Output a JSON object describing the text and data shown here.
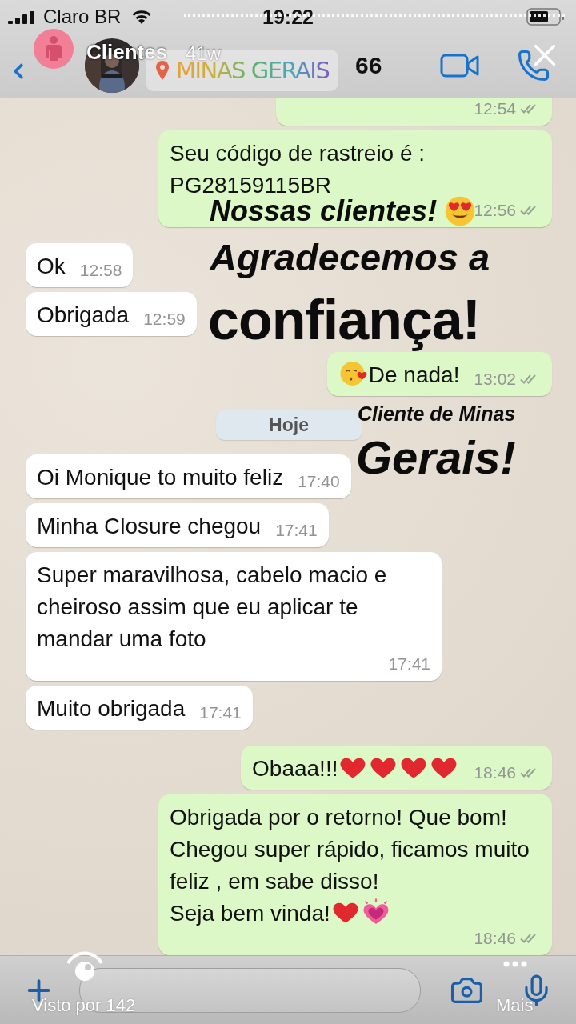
{
  "status_bar": {
    "carrier": "Claro BR",
    "time": "19:22"
  },
  "story": {
    "user": "Clientes",
    "age": "41w",
    "location": "MINAS GERAIS",
    "viewers": "Visto por 142",
    "more": "Mais"
  },
  "chat_header": {
    "count": "66"
  },
  "messages": [
    {
      "kind": "clipped",
      "time": "12:54",
      "read": false
    },
    {
      "kind": "sent",
      "lines": [
        "Seu código de rastreio é : PG28159115BR"
      ],
      "time": "12:56",
      "read": false
    },
    {
      "kind": "received",
      "lines": [
        "Ok"
      ],
      "time": "12:58"
    },
    {
      "kind": "received",
      "lines": [
        "Obrigada"
      ],
      "time": "12:59"
    },
    {
      "kind": "sent",
      "lead_icons": [
        {
          "kind": "kiss"
        }
      ],
      "lines": [
        "De nada!"
      ],
      "time": "13:02",
      "read": false
    },
    {
      "kind": "date",
      "text": "Hoje"
    },
    {
      "kind": "received",
      "lines": [
        "Oi Monique to muito feliz"
      ],
      "time": "17:40"
    },
    {
      "kind": "received",
      "lines": [
        "Minha Closure chegou"
      ],
      "time": "17:41"
    },
    {
      "kind": "received",
      "lines": [
        "Super maravilhosa, cabelo macio e cheiroso assim que eu aplicar te mandar uma foto"
      ],
      "time": "17:41"
    },
    {
      "kind": "received",
      "lines": [
        "Muito obrigada"
      ],
      "time": "17:41"
    },
    {
      "kind": "sent",
      "lines": [
        "Obaaa!!!"
      ],
      "trail_icons": [
        {
          "kind": "heart"
        },
        {
          "kind": "heart"
        },
        {
          "kind": "heart"
        },
        {
          "kind": "heart"
        }
      ],
      "time": "18:46",
      "read": false
    },
    {
      "kind": "sent",
      "lines": [
        "Obrigada por o retorno! Que bom! Chegou super rápido, ficamos muito feliz , em sabe disso!",
        "Seja bem vinda!"
      ],
      "trail_icons": [
        {
          "kind": "heart"
        },
        {
          "kind": "beating-heart"
        }
      ],
      "time": "18:46",
      "read": false
    }
  ],
  "stickers": [
    {
      "text": "Nossas clientes!",
      "icons": [
        {
          "kind": "heart-eyes"
        }
      ]
    },
    {
      "text": "Agradecemos a"
    },
    {
      "text": "confiança!"
    },
    {
      "text": "Cliente de Minas"
    },
    {
      "text": "Gerais!"
    }
  ]
}
